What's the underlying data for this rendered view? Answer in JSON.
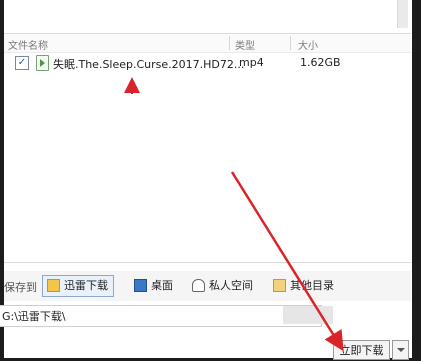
{
  "list": {
    "headers": {
      "name": "文件名称",
      "type": "类型",
      "size": "大小"
    },
    "files": [
      {
        "checked": true,
        "checkmark": "✓",
        "name": "失眠.The.Sleep.Curse.2017.HD72...",
        "type": "mp4",
        "size": "1.62GB"
      }
    ]
  },
  "save": {
    "label": "保存到",
    "locations": [
      {
        "label": "迅雷下载",
        "icon": "xunlei-folder-icon",
        "active": true
      },
      {
        "label": "桌面",
        "icon": "desktop-icon",
        "active": false
      },
      {
        "label": "私人空间",
        "icon": "cloud-icon",
        "active": false
      },
      {
        "label": "其他目录",
        "icon": "folder-icon",
        "active": false
      }
    ],
    "path": "G:\\迅雷下载\\"
  },
  "actions": {
    "download_label": "立即下载"
  },
  "colors": {
    "annotation_arrow": "#d9252a",
    "accent": "#1b5fb5"
  }
}
